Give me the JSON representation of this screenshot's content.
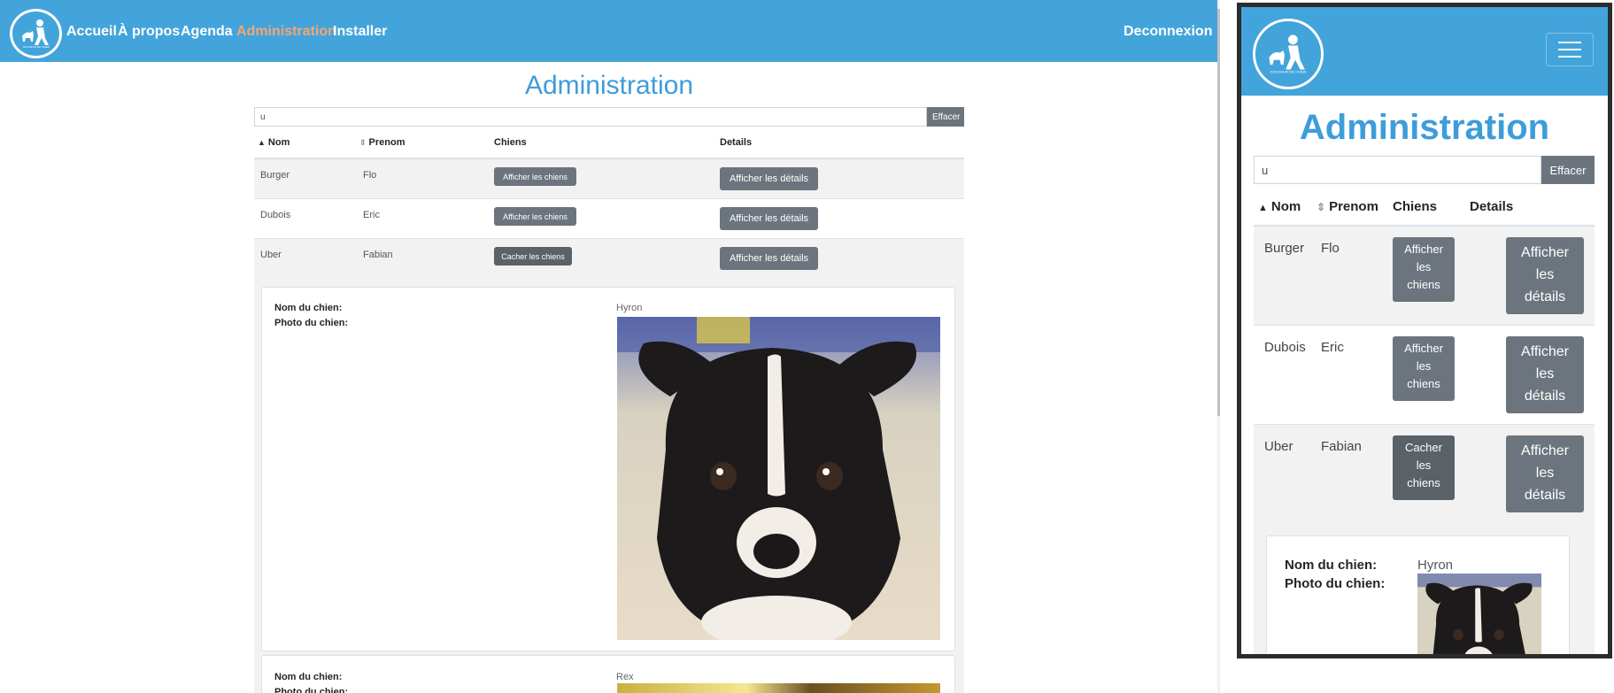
{
  "nav": {
    "links": [
      "Accueil",
      "À propos",
      "Agenda",
      "Administration",
      "Installer"
    ],
    "active": "Administration",
    "logout": "Deconnexion",
    "logo_text": "DOUCEUR DE CHIEN"
  },
  "admin": {
    "title": "Administration",
    "search_value": "u",
    "clear_label": "Effacer",
    "columns": [
      "Nom",
      "Prenom",
      "Chiens",
      "Details"
    ],
    "rows": [
      {
        "nom": "Burger",
        "prenom": "Flo",
        "chiens_btn": "Afficher les chiens",
        "details_btn": "Afficher les détails"
      },
      {
        "nom": "Dubois",
        "prenom": "Eric",
        "chiens_btn": "Afficher les chiens",
        "details_btn": "Afficher les détails"
      },
      {
        "nom": "Uber",
        "prenom": "Fabian",
        "chiens_btn": "Cacher les chiens",
        "details_btn": "Afficher les détails"
      }
    ],
    "dog_name_label": "Nom du chien:",
    "dog_photo_label": "Photo du chien:",
    "dogs": [
      {
        "name": "Hyron"
      },
      {
        "name": "Rex"
      }
    ]
  },
  "mobile": {
    "rows": [
      {
        "chiens_btn": [
          "Afficher",
          "les",
          "chiens"
        ],
        "details_btn": [
          "Afficher",
          "les",
          "détails"
        ]
      },
      {
        "chiens_btn": [
          "Afficher",
          "les",
          "chiens"
        ],
        "details_btn": [
          "Afficher",
          "les",
          "détails"
        ]
      },
      {
        "chiens_btn": [
          "Cacher",
          "les",
          "chiens"
        ],
        "details_btn": [
          "Afficher",
          "les",
          "détails"
        ]
      }
    ]
  },
  "colors": {
    "navbar": "#42a4db",
    "active_link": "#f4a673",
    "title": "#3d9ddb",
    "button": "#6c757d"
  },
  "icons": {
    "logo": "dog-trainer-logo-icon",
    "sort": "sort-arrows-icon",
    "menu": "hamburger-icon"
  }
}
